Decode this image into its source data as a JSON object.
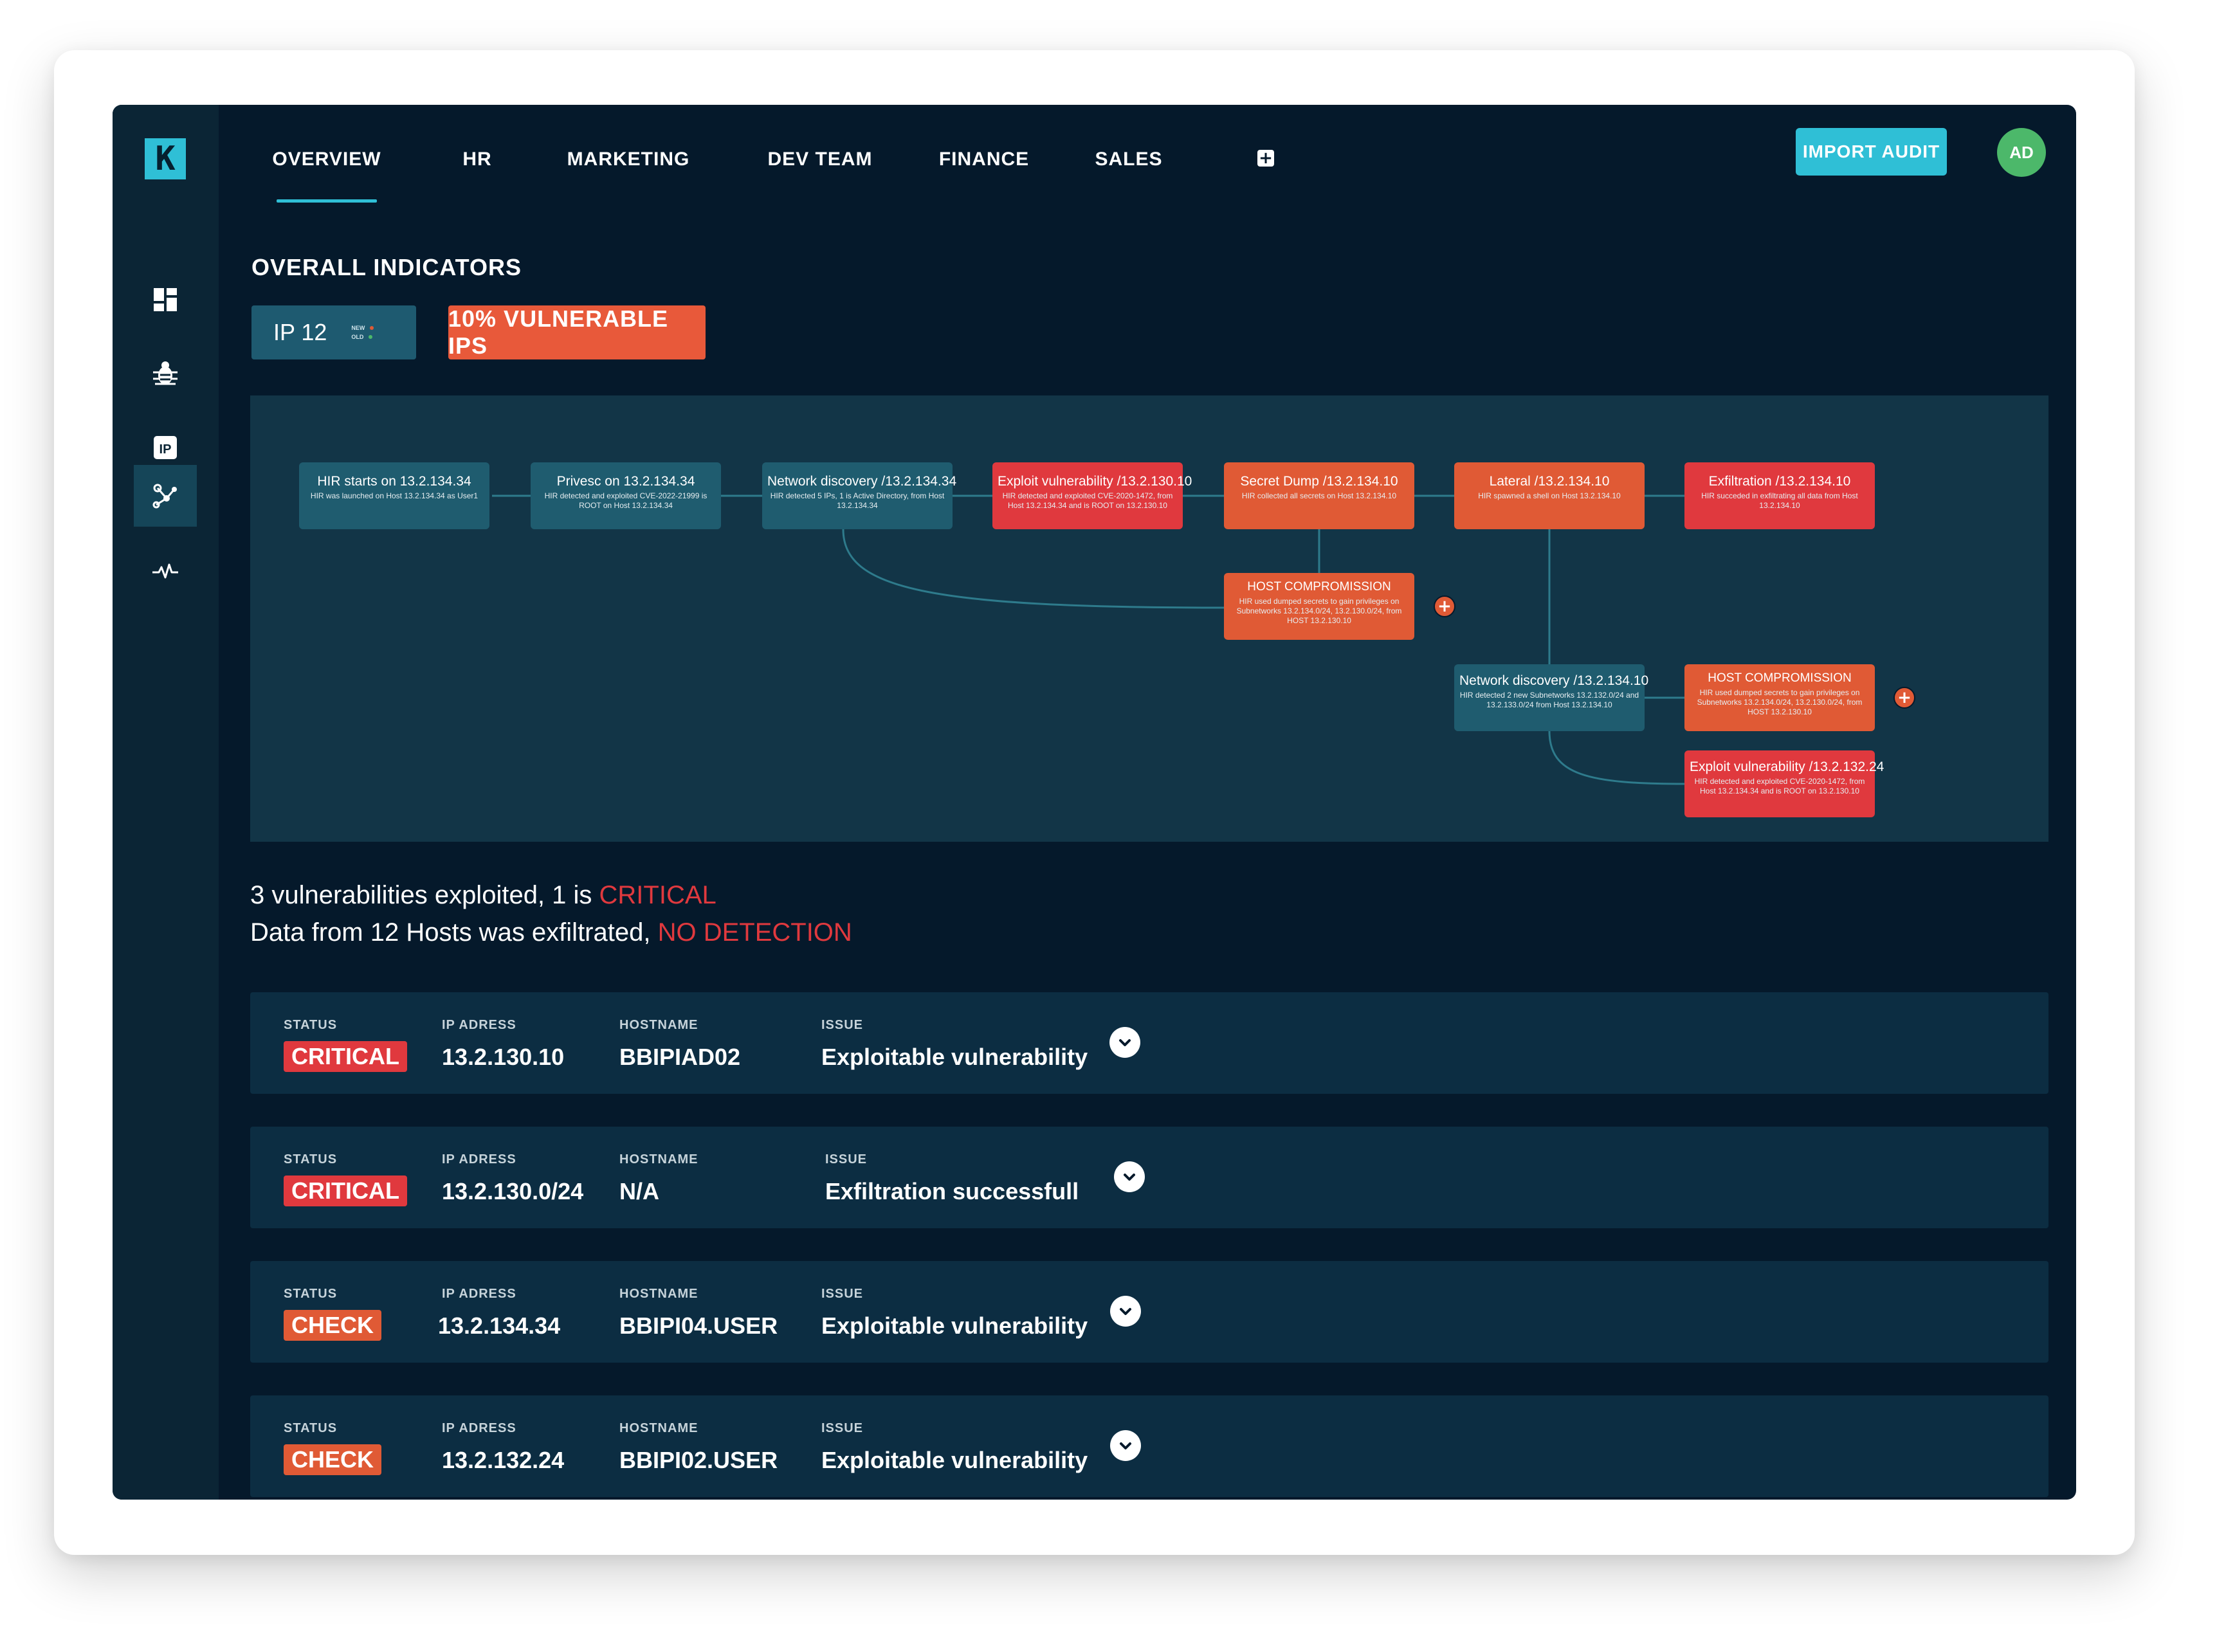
{
  "app": {
    "logo_letter": "K",
    "tabs": [
      "OVERVIEW",
      "HR",
      "MARKETING",
      "DEV TEAM",
      "FINANCE",
      "SALES"
    ],
    "active_tab": "OVERVIEW",
    "add_tab_symbol": "+",
    "import_label": "IMPORT AUDIT",
    "avatar_initials": "AD",
    "accent_color": "#2fbfd6"
  },
  "sidebar": {
    "items": [
      {
        "icon": "dashboard-icon",
        "active": false
      },
      {
        "icon": "bug-icon",
        "active": false
      },
      {
        "icon": "ip-icon",
        "label": "IP",
        "active": false
      },
      {
        "icon": "network-graph-icon",
        "active": true
      },
      {
        "icon": "activity-icon",
        "active": false
      }
    ]
  },
  "indicators": {
    "title": "OVERALL INDICATORS",
    "ip_label": "IP 12",
    "legend_new": "NEW",
    "legend_old": "OLD",
    "vulnerable": "10% VULNERABLE IPS"
  },
  "graph": {
    "nodes": [
      {
        "title": "HIR starts on 13.2.134.34",
        "desc": "HIR was launched on Host 13.2.134.34 as User1",
        "status": "teal"
      },
      {
        "title": "Privesc on 13.2.134.34",
        "desc": "HIR detected and exploited CVE-2022-21999 is ROOT on Host 13.2.134.34",
        "status": "teal"
      },
      {
        "title": "Network discovery /13.2.134.34",
        "desc": "HIR detected 5 IPs, 1 is Active Directory, from Host 13.2.134.34",
        "status": "teal"
      },
      {
        "title": "Exploit vulnerability /13.2.130.10",
        "desc": "HIR detected and exploited CVE-2020-1472, from Host 13.2.134.34 and is ROOT on 13.2.130.10",
        "status": "red"
      },
      {
        "title": "Secret Dump /13.2.134.10",
        "desc": "HIR collected all secrets on Host 13.2.134.10",
        "status": "orange"
      },
      {
        "title": "Lateral /13.2.134.10",
        "desc": "HIR spawned a shell on Host 13.2.134.10",
        "status": "orange"
      },
      {
        "title": "Exfiltration /13.2.134.10",
        "desc": "HIR succeded in exfiltrating all data from Host 13.2.134.10",
        "status": "red"
      },
      {
        "title": "HOST COMPROMISSION",
        "desc": "HIR used dumped secrets to gain privileges on Subnetworks 13.2.134.0/24, 13.2.130.0/24, from HOST 13.2.130.10",
        "status": "orange"
      },
      {
        "title": "Network discovery /13.2.134.10",
        "desc": "HIR detected 2 new Subnetworks 13.2.132.0/24 and 13.2.133.0/24 from Host 13.2.134.10",
        "status": "teal"
      },
      {
        "title": "HOST COMPROMISSION",
        "desc": "HIR used dumped secrets to gain privileges on Subnetworks 13.2.134.0/24, 13.2.130.0/24, from HOST 13.2.130.10",
        "status": "orange"
      },
      {
        "title": "Exploit vulnerability /13.2.132.24",
        "desc": "HIR detected and exploited CVE-2020-1472, from Host 13.2.134.34 and is ROOT on 13.2.130.10",
        "status": "red"
      }
    ],
    "colors": {
      "teal": "#1f5c6f",
      "orange": "#e05a35",
      "red": "#e0393e",
      "edge": "#2e7b8c"
    }
  },
  "summary": {
    "line1_prefix": "3 vulnerabilities exploited, 1 is ",
    "line1_highlight": "CRITICAL",
    "line2_prefix": "Data from 12 Hosts was exfiltrated, ",
    "line2_highlight": "NO DETECTION"
  },
  "table": {
    "headers": {
      "status": "STATUS",
      "ip": "IP ADRESS",
      "hostname": "HOSTNAME",
      "issue": "ISSUE"
    },
    "rows": [
      {
        "status": "CRITICAL",
        "status_color": "#e0393e",
        "ip": "13.2.130.10",
        "hostname": "BBIPIAD02",
        "issue": "Exploitable vulnerability"
      },
      {
        "status": "CRITICAL",
        "status_color": "#e0393e",
        "ip": "13.2.130.0/24",
        "hostname": "N/A",
        "issue": "Exfiltration successfull"
      },
      {
        "status": "CHECK",
        "status_color": "#e05a35",
        "ip": "13.2.134.34",
        "hostname": "BBIPI04.USER",
        "issue": "Exploitable vulnerability"
      },
      {
        "status": "CHECK",
        "status_color": "#e05a35",
        "ip": "13.2.132.24",
        "hostname": "BBIPI02.USER",
        "issue": "Exploitable vulnerability"
      }
    ]
  }
}
